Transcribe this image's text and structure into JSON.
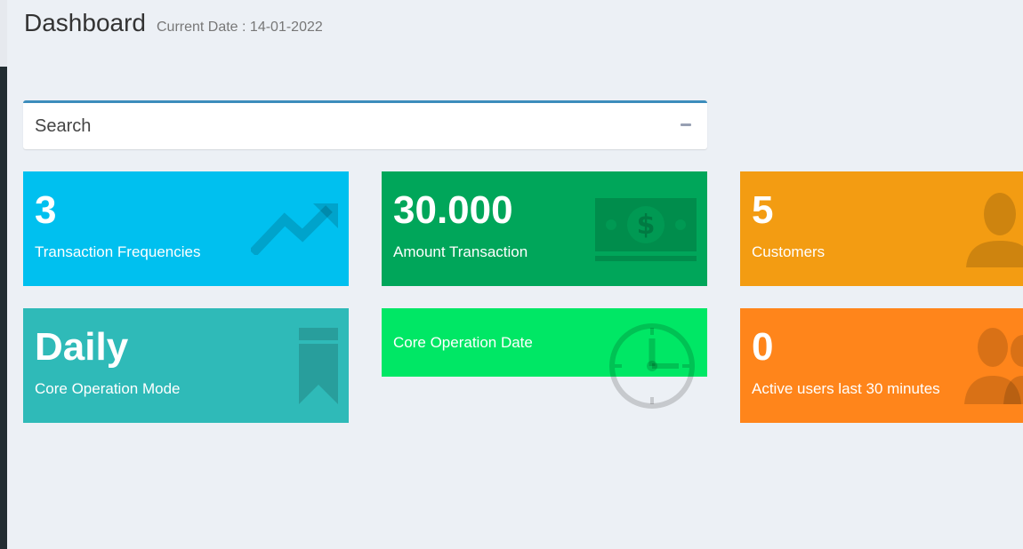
{
  "header": {
    "title": "Dashboard",
    "subtitle": "Current Date : 14-01-2022"
  },
  "search": {
    "title": "Search",
    "collapse_icon": "minus-icon"
  },
  "stats": [
    {
      "value": "3",
      "label": "Transaction Frequencies",
      "color": "#00c0ef",
      "icon": "line-chart-icon"
    },
    {
      "value": "30.000",
      "label": "Amount Transaction",
      "color": "#00a65a",
      "icon": "money-icon"
    },
    {
      "value": "5",
      "label": "Customers",
      "color": "#f39c12",
      "icon": "user-icon"
    },
    {
      "value": "Daily",
      "label": "Core Operation Mode",
      "color": "#2fbab8",
      "icon": "bookmark-icon"
    },
    {
      "value": "",
      "label": "Core Operation Date",
      "color": "#00e765",
      "icon": "clock-icon"
    },
    {
      "value": "0",
      "label": "Active users last 30 minutes",
      "color": "#ff851b",
      "icon": "users-icon"
    }
  ]
}
